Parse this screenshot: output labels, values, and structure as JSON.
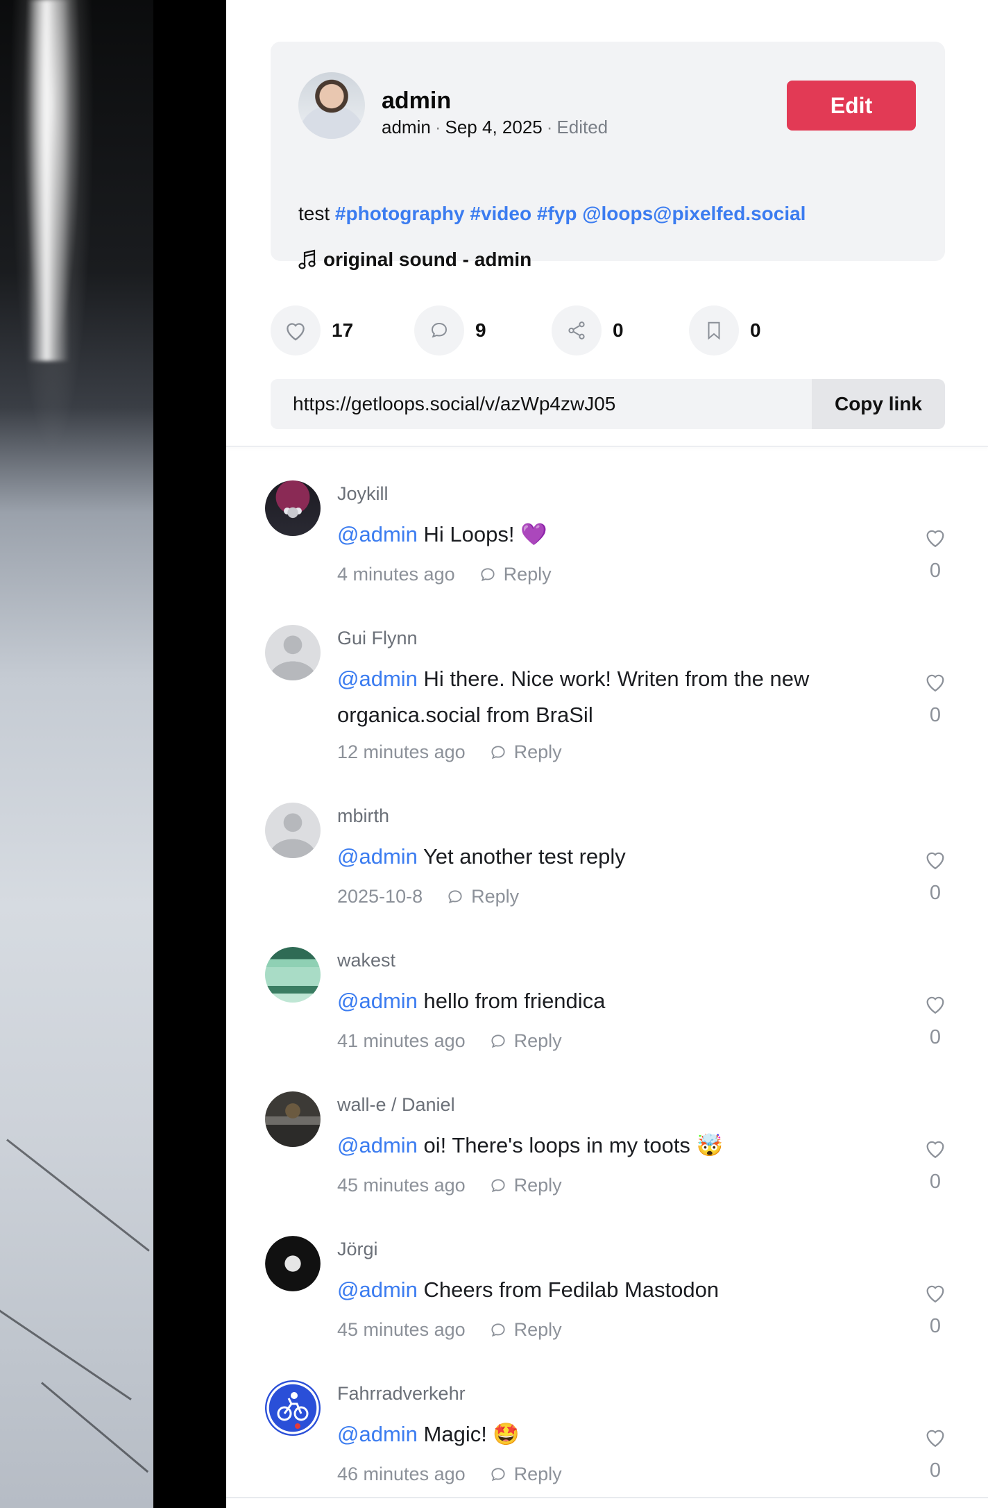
{
  "post": {
    "author_name": "admin",
    "author_handle": "admin",
    "date": "Sep 4, 2025",
    "edited": "Edited",
    "edit_label": "Edit",
    "caption_text": "test",
    "tags": [
      "#photography",
      "#video",
      "#fyp",
      "@loops@pixelfed.social"
    ],
    "sound": "original sound - admin"
  },
  "stats": {
    "likes": "17",
    "comments": "9",
    "shares": "0",
    "bookmarks": "0"
  },
  "share_link": {
    "url": "https://getloops.social/v/azWp4zwJ05",
    "copy_label": "Copy link"
  },
  "comments": [
    {
      "user": "Joykill",
      "mention": "@admin",
      "text": " Hi Loops! 💜",
      "time": "4 minutes ago",
      "reply": "Reply",
      "likes": "0"
    },
    {
      "user": "Gui Flynn",
      "mention": "@admin",
      "text": " Hi there. Nice work! Writen from the new organica.social from BraSil",
      "time": "12 minutes ago",
      "reply": "Reply",
      "likes": "0"
    },
    {
      "user": "mbirth",
      "mention": "@admin",
      "text": " Yet another test reply",
      "time": "2025-10-8",
      "reply": "Reply",
      "likes": "0"
    },
    {
      "user": "wakest",
      "mention": "@admin",
      "text": " hello from friendica",
      "time": "41 minutes ago",
      "reply": "Reply",
      "likes": "0"
    },
    {
      "user": "wall-e / Daniel",
      "mention": "@admin",
      "text": " oi! There's loops in my toots 🤯",
      "time": "45 minutes ago",
      "reply": "Reply",
      "likes": "0"
    },
    {
      "user": "Jörgi",
      "mention": "@admin",
      "text": " Cheers from Fedilab Mastodon",
      "time": "45 minutes ago",
      "reply": "Reply",
      "likes": "0"
    },
    {
      "user": "Fahrradverkehr",
      "mention": "@admin",
      "text": " Magic! 🤩",
      "time": "46 minutes ago",
      "reply": "Reply",
      "likes": "0"
    }
  ],
  "colors": {
    "accent": "#3b7cf0",
    "edit_button": "#e23a55",
    "card_bg": "#f2f3f5",
    "muted_text": "#8c9199"
  },
  "icons": {
    "like": "heart-icon",
    "comment": "comment-icon",
    "share": "share-icon",
    "bookmark": "bookmark-icon",
    "sound": "music-note-icon",
    "reply": "reply-icon"
  }
}
